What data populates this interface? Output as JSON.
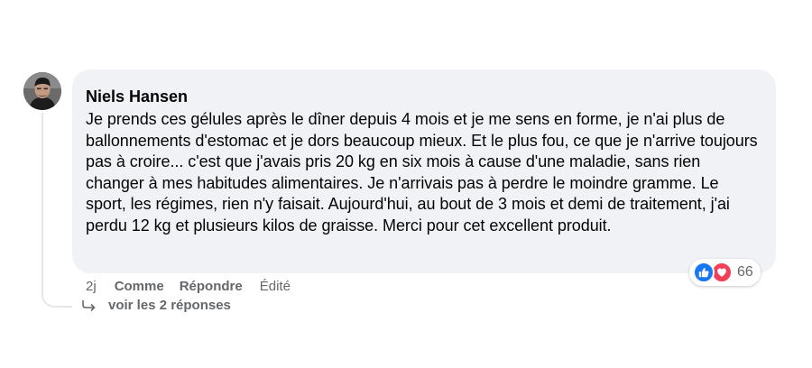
{
  "comment": {
    "author": "Niels Hansen",
    "text": "Je prends ces gélules après le dîner depuis 4 mois et je me sens en forme, je n'ai plus de ballonnements d'estomac et je dors beaucoup mieux. Et le plus fou, ce que je n'arrive toujours pas à croire... c'est que j'avais pris 20 kg en six mois à cause d'une maladie, sans rien changer à mes habitudes alimentaires. Je n'arrivais pas à perdre le moindre gramme. Le sport, les régimes, rien n'y faisait. Aujourd'hui, au bout de 3 mois et demi de traitement, j'ai perdu 12 kg et plusieurs kilos de graisse. Merci pour cet excellent produit.",
    "reactions": {
      "icons": [
        "like-icon",
        "love-icon"
      ],
      "count": "66"
    },
    "actions": {
      "time": "2j",
      "like_label": "Comme",
      "reply_label": "Répondre",
      "edited_label": "Édité"
    },
    "replies_label": "voir les 2 réponses"
  },
  "colors": {
    "bubble_bg": "#f0f2f5",
    "like_blue": "#1877f2",
    "love_red": "#f33e58",
    "meta_gray": "#65676b",
    "text": "#050505"
  }
}
